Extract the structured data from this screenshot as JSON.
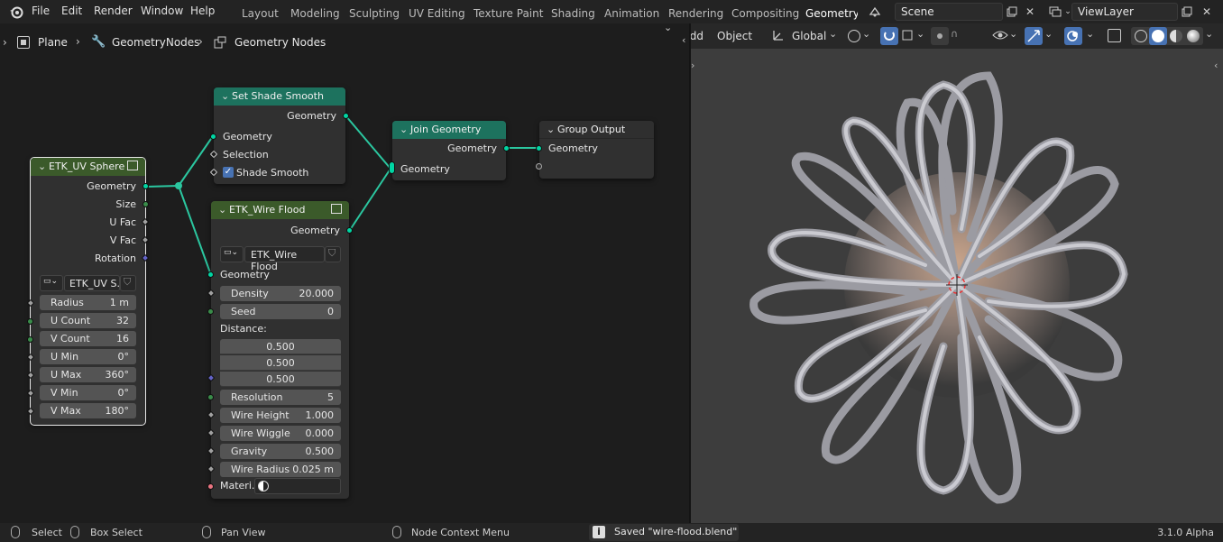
{
  "menu": {
    "file": "File",
    "edit": "Edit",
    "render": "Render",
    "window": "Window",
    "help": "Help"
  },
  "workspaces": [
    "Layout",
    "Modeling",
    "Sculpting",
    "UV Editing",
    "Texture Paint",
    "Shading",
    "Animation",
    "Rendering",
    "Compositing",
    "Geometry N"
  ],
  "active_workspace": "Geometry N",
  "scene": {
    "value": "Scene"
  },
  "view_layer": {
    "value": "ViewLayer"
  },
  "breadcrumb": {
    "object": "Plane",
    "modifier": "GeometryNodes",
    "tree": "Geometry Nodes"
  },
  "nodes": {
    "uv_sphere": {
      "title": "ETK_UV Sphere",
      "outputs": [
        "Geometry",
        "Size",
        "U Fac",
        "V Fac",
        "Rotation"
      ],
      "group": "ETK_UV S...",
      "inputs": [
        {
          "label": "Radius",
          "value": "1 m"
        },
        {
          "label": "U Count",
          "value": "32"
        },
        {
          "label": "V Count",
          "value": "16"
        },
        {
          "label": "U Min",
          "value": "0°"
        },
        {
          "label": "U Max",
          "value": "360°"
        },
        {
          "label": "V Min",
          "value": "0°"
        },
        {
          "label": "V Max",
          "value": "180°"
        }
      ]
    },
    "shade_smooth": {
      "title": "Set Shade Smooth",
      "output": "Geometry",
      "geometry": "Geometry",
      "selection": "Selection",
      "shade_smooth": "Shade Smooth"
    },
    "wire_flood": {
      "title": "ETK_Wire Flood",
      "output": "Geometry",
      "group": "ETK_Wire Flood",
      "geometry": "Geometry",
      "density": {
        "label": "Density",
        "value": "20.000"
      },
      "seed": {
        "label": "Seed",
        "value": "0"
      },
      "distance_label": "Distance:",
      "distance": [
        "0.500",
        "0.500",
        "0.500"
      ],
      "resolution": {
        "label": "Resolution",
        "value": "5"
      },
      "wire_height": {
        "label": "Wire Height",
        "value": "1.000"
      },
      "wire_wiggle": {
        "label": "Wire Wiggle",
        "value": "0.000"
      },
      "gravity": {
        "label": "Gravity",
        "value": "0.500"
      },
      "wire_radius": {
        "label": "Wire Radius",
        "value": "0.025 m"
      },
      "material": "Materi..."
    },
    "join_geometry": {
      "title": "Join Geometry",
      "output": "Geometry",
      "input": "Geometry"
    },
    "group_output": {
      "title": "Group Output",
      "input": "Geometry"
    }
  },
  "viewport": {
    "add": "Add",
    "object": "Object",
    "orientation": "Global"
  },
  "status": {
    "select": "Select",
    "box_select": "Box Select",
    "pan_view": "Pan View",
    "context_menu": "Node Context Menu",
    "message": "Saved \"wire-flood.blend\"",
    "version": "3.1.0 Alpha"
  },
  "colors": {
    "geometry_socket": "#00d6a3",
    "set_header": "#1d725e",
    "group_header": "#3b5a2a",
    "wire": "#2bc7a0"
  }
}
